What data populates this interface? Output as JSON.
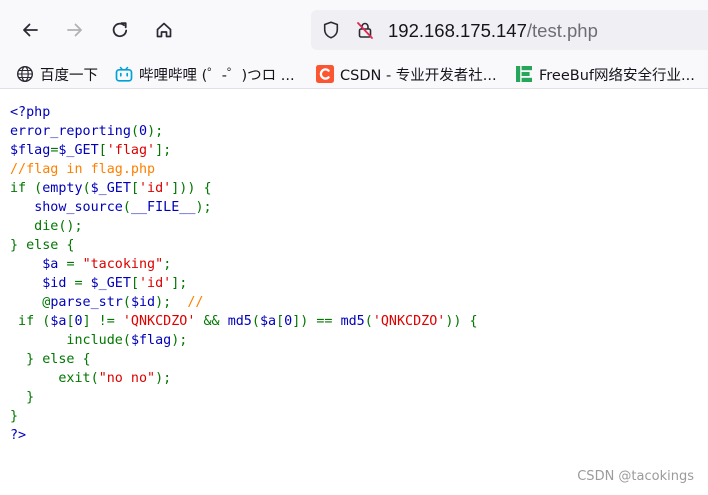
{
  "browser": {
    "url_host": "192.168.175.147",
    "url_path": "/test.php",
    "colors": {
      "toolbar_bg": "#f9f9fb",
      "urlbar_bg": "#f0f0f4"
    }
  },
  "bookmarks": [
    {
      "label": "百度一下",
      "icon": "globe-icon"
    },
    {
      "label": "哔哩哔哩 (゜-゜)つロ ...",
      "icon": "bilibili-icon"
    },
    {
      "label": "CSDN - 专业开发者社...",
      "icon": "csdn-icon"
    },
    {
      "label": "FreeBuf网络安全行业...",
      "icon": "freebuf-icon"
    }
  ],
  "code": {
    "colors": {
      "default": "#0000bb",
      "keyword": "#007700",
      "string": "#dd0000",
      "comment": "#ff8000"
    },
    "lines": [
      [
        [
          "default",
          "<?php"
        ]
      ],
      [
        [
          "default",
          "error_reporting"
        ],
        [
          "keyword",
          "("
        ],
        [
          "default",
          "0"
        ],
        [
          "keyword",
          ");"
        ]
      ],
      [
        [
          "default",
          "$flag"
        ],
        [
          "keyword",
          "="
        ],
        [
          "default",
          "$_GET"
        ],
        [
          "keyword",
          "["
        ],
        [
          "string",
          "'flag'"
        ],
        [
          "keyword",
          "];"
        ]
      ],
      [
        [
          "comment",
          "//flag in flag.php"
        ]
      ],
      [
        [
          "keyword",
          "if ("
        ],
        [
          "default",
          "empty"
        ],
        [
          "keyword",
          "("
        ],
        [
          "default",
          "$_GET"
        ],
        [
          "keyword",
          "["
        ],
        [
          "string",
          "'id'"
        ],
        [
          "keyword",
          "])) {"
        ]
      ],
      [
        [
          "keyword",
          "   "
        ],
        [
          "default",
          "show_source"
        ],
        [
          "keyword",
          "("
        ],
        [
          "default",
          "__FILE__"
        ],
        [
          "keyword",
          ");"
        ]
      ],
      [
        [
          "keyword",
          "   die();"
        ]
      ],
      [
        [
          "keyword",
          "} else {"
        ]
      ],
      [
        [
          "keyword",
          "    "
        ],
        [
          "default",
          "$a "
        ],
        [
          "keyword",
          "= "
        ],
        [
          "string",
          "\"tacoking\""
        ],
        [
          "keyword",
          ";"
        ]
      ],
      [
        [
          "keyword",
          "    "
        ],
        [
          "default",
          "$id "
        ],
        [
          "keyword",
          "= "
        ],
        [
          "default",
          "$_GET"
        ],
        [
          "keyword",
          "["
        ],
        [
          "string",
          "'id'"
        ],
        [
          "keyword",
          "];"
        ]
      ],
      [
        [
          "keyword",
          "    @"
        ],
        [
          "default",
          "parse_str"
        ],
        [
          "keyword",
          "("
        ],
        [
          "default",
          "$id"
        ],
        [
          "keyword",
          ");  "
        ],
        [
          "comment",
          "//"
        ]
      ],
      [
        [
          "keyword",
          " if ("
        ],
        [
          "default",
          "$a"
        ],
        [
          "keyword",
          "["
        ],
        [
          "default",
          "0"
        ],
        [
          "keyword",
          "] != "
        ],
        [
          "string",
          "'QNKCDZO' "
        ],
        [
          "keyword",
          "&& "
        ],
        [
          "default",
          "md5"
        ],
        [
          "keyword",
          "("
        ],
        [
          "default",
          "$a"
        ],
        [
          "keyword",
          "["
        ],
        [
          "default",
          "0"
        ],
        [
          "keyword",
          "]) == "
        ],
        [
          "default",
          "md5"
        ],
        [
          "keyword",
          "("
        ],
        [
          "string",
          "'QNKCDZO'"
        ],
        [
          "keyword",
          ")) {"
        ]
      ],
      [
        [
          "keyword",
          "       include("
        ],
        [
          "default",
          "$flag"
        ],
        [
          "keyword",
          ");"
        ]
      ],
      [
        [
          "keyword",
          "  } else {"
        ]
      ],
      [
        [
          "keyword",
          "      exit("
        ],
        [
          "string",
          "\"no no\""
        ],
        [
          "keyword",
          ");"
        ]
      ],
      [
        [
          "keyword",
          "  }"
        ]
      ],
      [
        [
          "keyword",
          "}"
        ]
      ],
      [
        [
          "default",
          "?>"
        ]
      ]
    ]
  },
  "watermark": "CSDN @tacokings"
}
